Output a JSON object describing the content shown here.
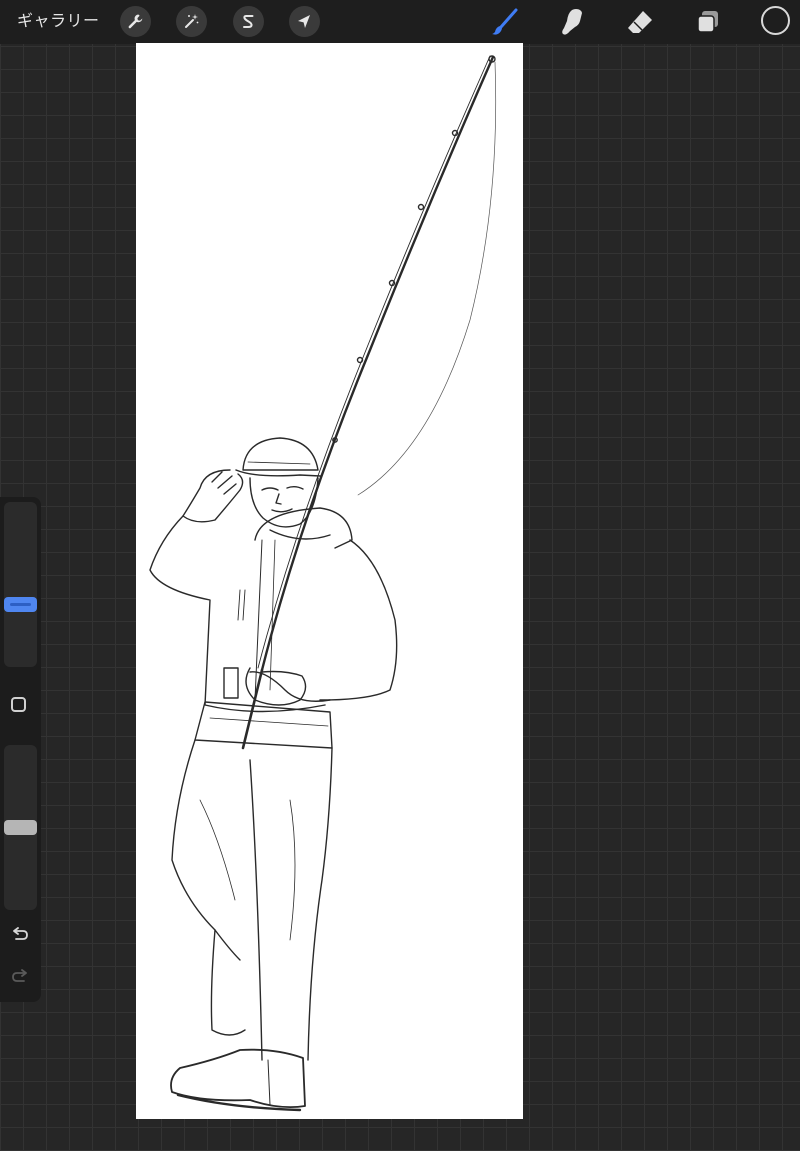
{
  "toolbar": {
    "gallery_label": "ギャラリー",
    "left_tools": [
      {
        "name": "actions",
        "icon": "wrench-icon"
      },
      {
        "name": "adjustments",
        "icon": "magic-wand-icon"
      },
      {
        "name": "selection",
        "icon": "selection-s-icon"
      },
      {
        "name": "transform",
        "icon": "arrow-cursor-icon"
      }
    ],
    "right_tools": [
      {
        "name": "brush",
        "icon": "brush-icon",
        "active": true
      },
      {
        "name": "smudge",
        "icon": "smudge-finger-icon",
        "active": false
      },
      {
        "name": "eraser",
        "icon": "eraser-icon",
        "active": false
      },
      {
        "name": "layers",
        "icon": "layers-icon",
        "active": false
      }
    ],
    "current_color": "#1e1e1e"
  },
  "sidebar": {
    "brush_size_level": 0.37,
    "opacity_level": 0.5,
    "modify_icon": "square-icon",
    "undo_icon": "undo-icon",
    "redo_icon": "redo-icon",
    "redo_enabled": false
  },
  "colors": {
    "accent": "#3f7cf4",
    "toolbar_bg": "#1e1e1e",
    "canvas_bg": "#ffffff"
  },
  "canvas": {
    "subject": "fisherman-sketch"
  }
}
